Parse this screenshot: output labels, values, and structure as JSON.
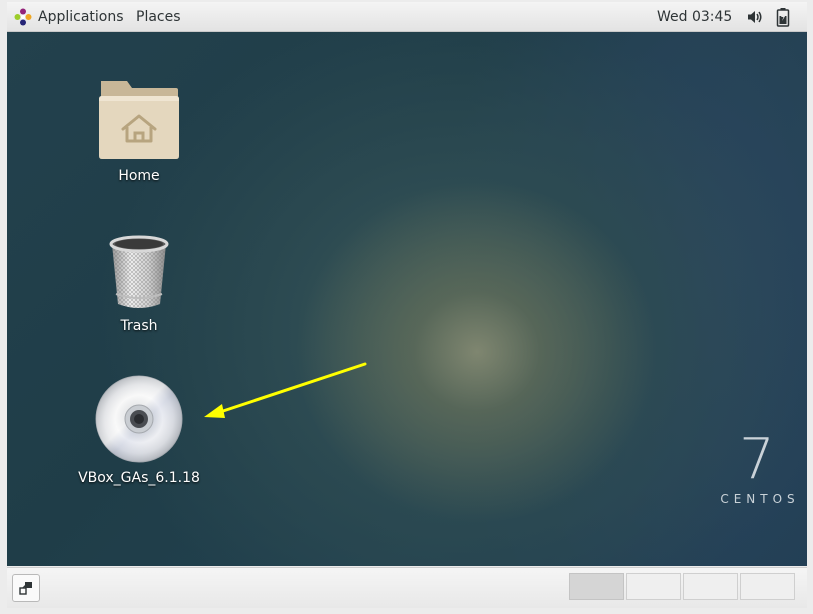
{
  "top_bar": {
    "applications_label": "Applications",
    "places_label": "Places",
    "clock": "Wed 03:45",
    "icons": [
      "applications-icon",
      "volume-icon",
      "battery-icon"
    ]
  },
  "desktop": {
    "icons": [
      {
        "label": "Home",
        "icon": "home-folder-icon"
      },
      {
        "label": "Trash",
        "icon": "trash-icon"
      },
      {
        "label": "VBox_GAs_6.1.18",
        "icon": "optical-disc-icon"
      }
    ],
    "annotation_arrow": {
      "color": "#ffff00",
      "points_to": "VBox_GAs_6.1.18"
    },
    "branding": {
      "number": "7",
      "name": "CENTOS"
    }
  },
  "bottom_bar": {
    "show_desktop_icon": "show-desktop-icon",
    "workspaces": [
      {
        "active": true
      },
      {
        "active": false
      },
      {
        "active": false
      },
      {
        "active": false
      }
    ]
  }
}
